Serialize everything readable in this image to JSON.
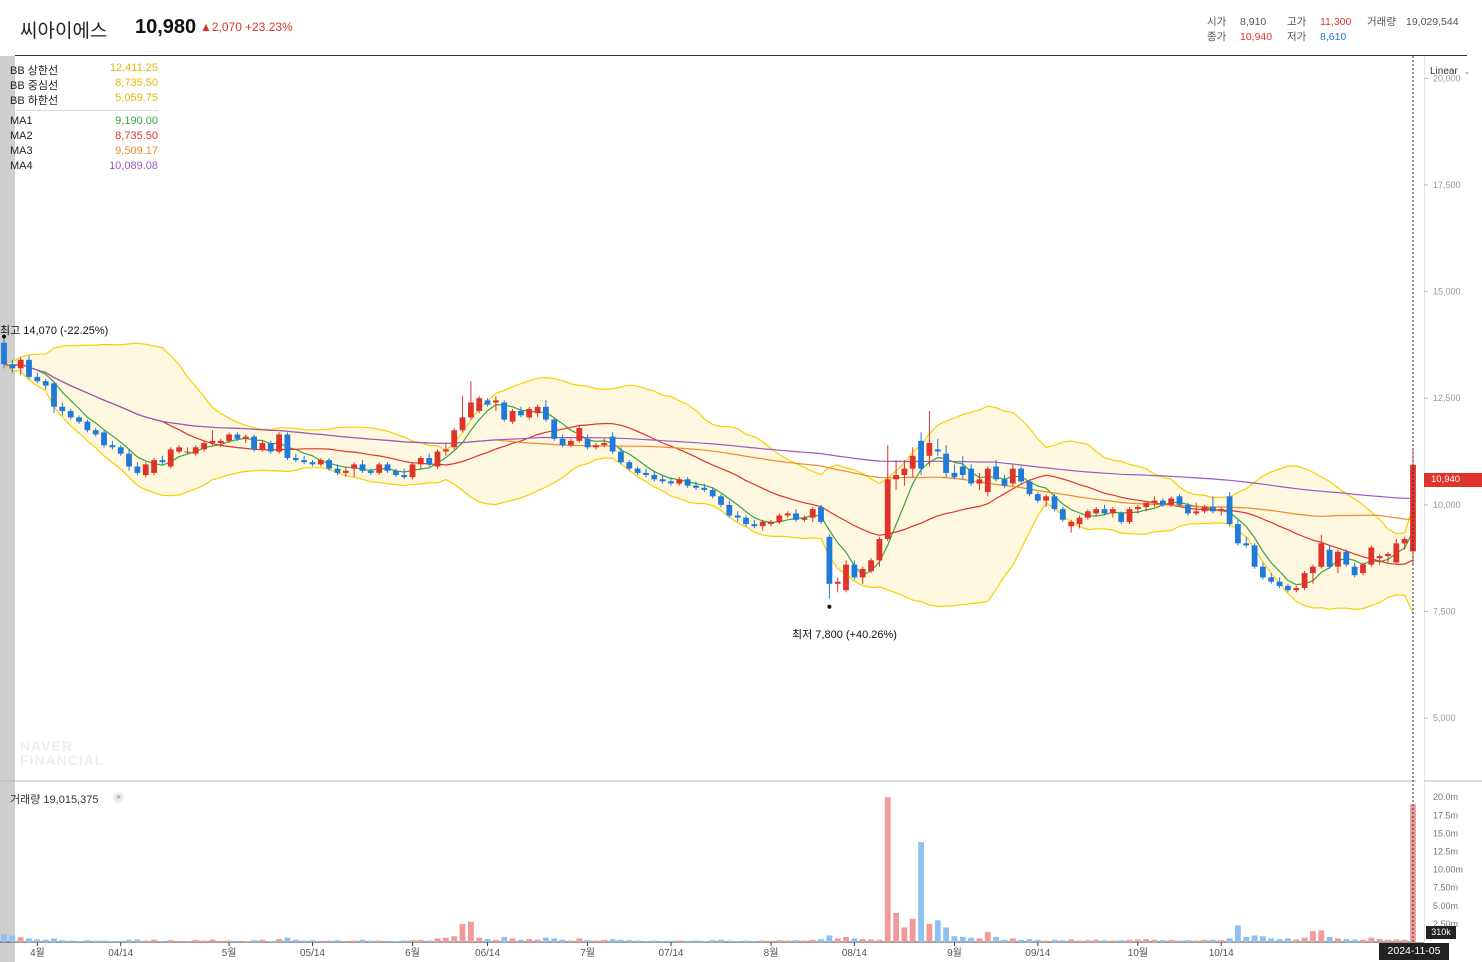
{
  "header": {
    "stock_name": "씨아이에스",
    "price": "10,980",
    "change": "▲2,070",
    "change_pct": "+23.23%",
    "open_label": "시가",
    "open_value": "8,910",
    "close_label": "종가",
    "close_value": "10,940",
    "high_label": "고가",
    "high_value": "11,300",
    "low_label": "저가",
    "low_value": "8,610",
    "volume_label": "거래량",
    "volume_value": "19,029,544"
  },
  "legend": {
    "bb": [
      {
        "label": "BB 상한선",
        "value": "12,411.25",
        "color": "#e8b800"
      },
      {
        "label": "BB 중심선",
        "value": "8,735.50",
        "color": "#e8b800"
      },
      {
        "label": "BB 하한선",
        "value": "5,059.75",
        "color": "#e8b800"
      }
    ],
    "ma": [
      {
        "label": "MA1",
        "value": "9,190.00",
        "color": "#3aa53a"
      },
      {
        "label": "MA2",
        "value": "8,735.50",
        "color": "#e0332b"
      },
      {
        "label": "MA3",
        "value": "9,509.17",
        "color": "#ee8a2a"
      },
      {
        "label": "MA4",
        "value": "10,089.08",
        "color": "#9b59c6"
      }
    ]
  },
  "scale_button": "Linear",
  "annotations": {
    "high": "최고 14,070 (-22.25%)",
    "low": "최저 7,800 (+40.26%)"
  },
  "volume_panel": {
    "label": "거래량 19,015,375",
    "close": "×"
  },
  "tags": {
    "price": "10,940",
    "volume": "310k",
    "date": "2024-11-05"
  },
  "watermark": [
    "NAVER",
    "FINANCIAL"
  ],
  "colors": {
    "up": "#e0332b",
    "down": "#1f7ad9",
    "band_fill": "#fff8e1",
    "band_line": "#f5d000"
  },
  "chart_data": {
    "type": "candlestick",
    "y_ticks": [
      "20,000",
      "17,500",
      "15,000",
      "12,500",
      "10,000",
      "7,500",
      "5,000"
    ],
    "y_range": [
      3550,
      20500
    ],
    "x_tick_labels": [
      "4월",
      "04/14",
      "5월",
      "05/14",
      "6월",
      "06/14",
      "7월",
      "07/14",
      "8월",
      "08/14",
      "9월",
      "09/14",
      "10월",
      "10/14"
    ],
    "x_tick_index": [
      4,
      14,
      27,
      37,
      49,
      58,
      70,
      80,
      92,
      102,
      114,
      124,
      136,
      146
    ],
    "volume_ticks": [
      "20.0m",
      "17.5m",
      "15.0m",
      "12.5m",
      "10.00m",
      "7.50m",
      "5.00m",
      "2.50m"
    ],
    "volume_range": [
      0,
      21000000
    ],
    "candles": [
      [
        13800,
        13900,
        13200,
        13300,
        1100000
      ],
      [
        13300,
        13400,
        13100,
        13200,
        900000
      ],
      [
        13200,
        13450,
        13050,
        13400,
        650000
      ],
      [
        13400,
        13500,
        12950,
        13000,
        500000
      ],
      [
        13000,
        13100,
        12850,
        12900,
        350000
      ],
      [
        12900,
        12950,
        12700,
        12800,
        300000
      ],
      [
        12850,
        12900,
        12150,
        12300,
        500000
      ],
      [
        12300,
        12400,
        12100,
        12200,
        250000
      ],
      [
        12200,
        12250,
        12000,
        12050,
        200000
      ],
      [
        12050,
        12100,
        11900,
        11950,
        150000
      ],
      [
        11950,
        12000,
        11700,
        11750,
        250000
      ],
      [
        11750,
        11800,
        11600,
        11650,
        180000
      ],
      [
        11700,
        11750,
        11350,
        11400,
        200000
      ],
      [
        11400,
        11500,
        11300,
        11350,
        120000
      ],
      [
        11350,
        11400,
        11150,
        11200,
        150000
      ],
      [
        11200,
        11300,
        10800,
        10900,
        300000
      ],
      [
        10900,
        11000,
        10700,
        10750,
        350000
      ],
      [
        10700,
        11000,
        10650,
        10950,
        200000
      ],
      [
        10750,
        11100,
        10700,
        11050,
        300000
      ],
      [
        11050,
        11150,
        10950,
        11000,
        150000
      ],
      [
        10900,
        11350,
        10850,
        11300,
        250000
      ],
      [
        11250,
        11400,
        11200,
        11350,
        150000
      ],
      [
        11250,
        11350,
        11200,
        11250,
        120000
      ],
      [
        11200,
        11400,
        11150,
        11350,
        300000
      ],
      [
        11300,
        11500,
        11250,
        11450,
        200000
      ],
      [
        11450,
        11750,
        11400,
        11500,
        350000
      ],
      [
        11450,
        11550,
        11350,
        11500,
        150000
      ],
      [
        11500,
        11700,
        11450,
        11650,
        200000
      ],
      [
        11650,
        11700,
        11500,
        11550,
        150000
      ],
      [
        11550,
        11650,
        11450,
        11600,
        120000
      ],
      [
        11600,
        11650,
        11250,
        11300,
        250000
      ],
      [
        11300,
        11500,
        11250,
        11450,
        300000
      ],
      [
        11450,
        11500,
        11200,
        11250,
        120000
      ],
      [
        11250,
        11700,
        11200,
        11650,
        400000
      ],
      [
        11650,
        11700,
        11050,
        11100,
        600000
      ],
      [
        11100,
        11200,
        11000,
        11050,
        300000
      ],
      [
        11050,
        11150,
        10950,
        11000,
        200000
      ],
      [
        11000,
        11050,
        10900,
        10950,
        250000
      ],
      [
        10950,
        11100,
        10900,
        11050,
        150000
      ],
      [
        11050,
        11100,
        10800,
        10850,
        200000
      ],
      [
        10850,
        10950,
        10700,
        10750,
        250000
      ],
      [
        10750,
        10900,
        10650,
        10800,
        150000
      ],
      [
        10850,
        11000,
        10650,
        10950,
        200000
      ],
      [
        10950,
        11050,
        10750,
        10800,
        300000
      ],
      [
        10800,
        10850,
        10700,
        10750,
        180000
      ],
      [
        10750,
        11000,
        10700,
        10950,
        200000
      ],
      [
        10950,
        11000,
        10750,
        10800,
        150000
      ],
      [
        10800,
        10850,
        10650,
        10700,
        120000
      ],
      [
        10700,
        10850,
        10600,
        10650,
        200000
      ],
      [
        10650,
        11000,
        10600,
        10950,
        250000
      ],
      [
        10950,
        11150,
        10850,
        11100,
        300000
      ],
      [
        11100,
        11200,
        10900,
        10950,
        200000
      ],
      [
        10900,
        11300,
        10850,
        11250,
        500000
      ],
      [
        11250,
        11450,
        11150,
        11300,
        600000
      ],
      [
        11350,
        11800,
        11300,
        11750,
        800000
      ],
      [
        11750,
        12550,
        11700,
        12050,
        2500000
      ],
      [
        12050,
        12900,
        12000,
        12400,
        2800000
      ],
      [
        12200,
        12550,
        12150,
        12500,
        600000
      ],
      [
        12450,
        12500,
        12300,
        12350,
        400000
      ],
      [
        12400,
        12550,
        12200,
        12450,
        300000
      ],
      [
        12400,
        12450,
        11950,
        12000,
        700000
      ],
      [
        11950,
        12250,
        11900,
        12200,
        500000
      ],
      [
        12200,
        12300,
        12050,
        12100,
        300000
      ],
      [
        12050,
        12300,
        12000,
        12250,
        400000
      ],
      [
        12150,
        12350,
        12050,
        12300,
        300000
      ],
      [
        12300,
        12450,
        11950,
        12000,
        600000
      ],
      [
        12000,
        12050,
        11500,
        11550,
        500000
      ],
      [
        11550,
        11650,
        11350,
        11400,
        300000
      ],
      [
        11400,
        11550,
        11350,
        11500,
        200000
      ],
      [
        11500,
        11850,
        11450,
        11800,
        500000
      ],
      [
        11550,
        11650,
        11300,
        11350,
        250000
      ],
      [
        11350,
        11450,
        11300,
        11400,
        200000
      ],
      [
        11400,
        11550,
        11350,
        11450,
        300000
      ],
      [
        11600,
        11700,
        11200,
        11250,
        400000
      ],
      [
        11250,
        11350,
        10950,
        11000,
        300000
      ],
      [
        11000,
        11050,
        10800,
        10850,
        250000
      ],
      [
        10850,
        10900,
        10700,
        10750,
        200000
      ],
      [
        10750,
        10850,
        10650,
        10700,
        150000
      ],
      [
        10700,
        10800,
        10550,
        10600,
        200000
      ],
      [
        10600,
        10700,
        10500,
        10550,
        150000
      ],
      [
        10550,
        10650,
        10450,
        10500,
        180000
      ],
      [
        10500,
        10650,
        10450,
        10600,
        200000
      ],
      [
        10600,
        10650,
        10400,
        10450,
        150000
      ],
      [
        10450,
        10550,
        10350,
        10400,
        200000
      ],
      [
        10400,
        10500,
        10300,
        10350,
        150000
      ],
      [
        10350,
        10400,
        10150,
        10200,
        250000
      ],
      [
        10200,
        10250,
        9950,
        10000,
        300000
      ],
      [
        10000,
        10100,
        9700,
        9750,
        200000
      ],
      [
        9750,
        9850,
        9600,
        9700,
        150000
      ],
      [
        9700,
        9750,
        9500,
        9550,
        200000
      ],
      [
        9550,
        9650,
        9450,
        9500,
        150000
      ],
      [
        9500,
        9650,
        9400,
        9600,
        200000
      ],
      [
        9550,
        9650,
        9500,
        9600,
        180000
      ],
      [
        9600,
        9800,
        9550,
        9750,
        250000
      ],
      [
        9750,
        9850,
        9700,
        9800,
        200000
      ],
      [
        9800,
        9900,
        9600,
        9650,
        250000
      ],
      [
        9650,
        9750,
        9600,
        9700,
        200000
      ],
      [
        9700,
        9950,
        9600,
        9900,
        300000
      ],
      [
        9950,
        10000,
        9550,
        9600,
        400000
      ],
      [
        9250,
        9300,
        7800,
        8150,
        900000
      ],
      [
        8150,
        8300,
        7950,
        8200,
        500000
      ],
      [
        8000,
        8700,
        7950,
        8600,
        700000
      ],
      [
        8600,
        8700,
        8250,
        8300,
        500000
      ],
      [
        8300,
        8550,
        8150,
        8500,
        400000
      ],
      [
        8450,
        8750,
        8400,
        8700,
        350000
      ],
      [
        8700,
        9250,
        8550,
        9200,
        300000
      ],
      [
        9200,
        11400,
        9150,
        10600,
        20000000
      ],
      [
        10600,
        11050,
        10350,
        10700,
        4000000
      ],
      [
        10700,
        11050,
        10450,
        10850,
        2000000
      ],
      [
        10850,
        11350,
        10650,
        11150,
        3200000
      ],
      [
        11500,
        11700,
        10700,
        10850,
        13800000
      ],
      [
        11150,
        12200,
        10900,
        11450,
        2500000
      ],
      [
        11300,
        11550,
        11150,
        11250,
        3000000
      ],
      [
        11200,
        11400,
        10650,
        10750,
        2000000
      ],
      [
        10750,
        10950,
        10600,
        10650,
        800000
      ],
      [
        10900,
        11150,
        10600,
        10700,
        700000
      ],
      [
        10850,
        10950,
        10450,
        10500,
        600000
      ],
      [
        10500,
        10750,
        10350,
        10600,
        500000
      ],
      [
        10300,
        10900,
        10200,
        10850,
        1400000
      ],
      [
        10900,
        11050,
        10550,
        10600,
        700000
      ],
      [
        10600,
        10700,
        10400,
        10450,
        300000
      ],
      [
        10500,
        10950,
        10450,
        10850,
        500000
      ],
      [
        10850,
        10900,
        10500,
        10550,
        300000
      ],
      [
        10550,
        10600,
        10200,
        10250,
        400000
      ],
      [
        10250,
        10300,
        10050,
        10100,
        300000
      ],
      [
        10100,
        10250,
        9950,
        10200,
        200000
      ],
      [
        10200,
        10250,
        9850,
        9900,
        300000
      ],
      [
        9900,
        9950,
        9600,
        9650,
        250000
      ],
      [
        9500,
        9650,
        9350,
        9600,
        350000
      ],
      [
        9550,
        9750,
        9450,
        9700,
        200000
      ],
      [
        9700,
        9900,
        9650,
        9850,
        250000
      ],
      [
        9800,
        9950,
        9750,
        9900,
        300000
      ],
      [
        9900,
        10000,
        9750,
        9800,
        250000
      ],
      [
        9800,
        9950,
        9700,
        9900,
        200000
      ],
      [
        9800,
        9850,
        9550,
        9600,
        250000
      ],
      [
        9600,
        9950,
        9550,
        9900,
        300000
      ],
      [
        9900,
        10000,
        9800,
        9950,
        350000
      ],
      [
        9950,
        10050,
        9850,
        10050,
        400000
      ],
      [
        10050,
        10200,
        9950,
        10100,
        300000
      ],
      [
        10100,
        10150,
        9950,
        10000,
        250000
      ],
      [
        10000,
        10200,
        9950,
        10150,
        300000
      ],
      [
        10200,
        10250,
        9950,
        10000,
        200000
      ],
      [
        10000,
        10050,
        9750,
        9800,
        250000
      ],
      [
        9800,
        10050,
        9750,
        9850,
        200000
      ],
      [
        9850,
        10000,
        9800,
        9950,
        300000
      ],
      [
        9950,
        10200,
        9800,
        9850,
        300000
      ],
      [
        9850,
        9950,
        9750,
        9900,
        250000
      ],
      [
        10200,
        10300,
        9500,
        9550,
        500000
      ],
      [
        9550,
        9650,
        9050,
        9100,
        2300000
      ],
      [
        9100,
        9250,
        9000,
        9050,
        700000
      ],
      [
        9050,
        9100,
        8500,
        8550,
        900000
      ],
      [
        8550,
        8650,
        8250,
        8300,
        800000
      ],
      [
        8300,
        8400,
        8150,
        8200,
        500000
      ],
      [
        8200,
        8300,
        8050,
        8100,
        400000
      ],
      [
        8100,
        8150,
        7950,
        8000,
        500000
      ],
      [
        8000,
        8100,
        7950,
        8050,
        350000
      ],
      [
        8050,
        8450,
        8000,
        8400,
        600000
      ],
      [
        8400,
        8600,
        8150,
        8550,
        1500000
      ],
      [
        8550,
        9300,
        8500,
        9100,
        1600000
      ],
      [
        8950,
        9050,
        8500,
        8550,
        700000
      ],
      [
        8550,
        8950,
        8400,
        8900,
        500000
      ],
      [
        8900,
        8950,
        8550,
        8600,
        400000
      ],
      [
        8550,
        8650,
        8300,
        8350,
        350000
      ],
      [
        8400,
        8650,
        8350,
        8600,
        300000
      ],
      [
        8600,
        9050,
        8550,
        9000,
        600000
      ],
      [
        8750,
        8850,
        8600,
        8800,
        400000
      ],
      [
        8800,
        8900,
        8650,
        8850,
        300000
      ],
      [
        8650,
        9200,
        8600,
        9100,
        350000
      ],
      [
        9100,
        9250,
        8950,
        9200,
        300000
      ],
      [
        8910,
        11300,
        8610,
        10940,
        19029544
      ]
    ]
  }
}
